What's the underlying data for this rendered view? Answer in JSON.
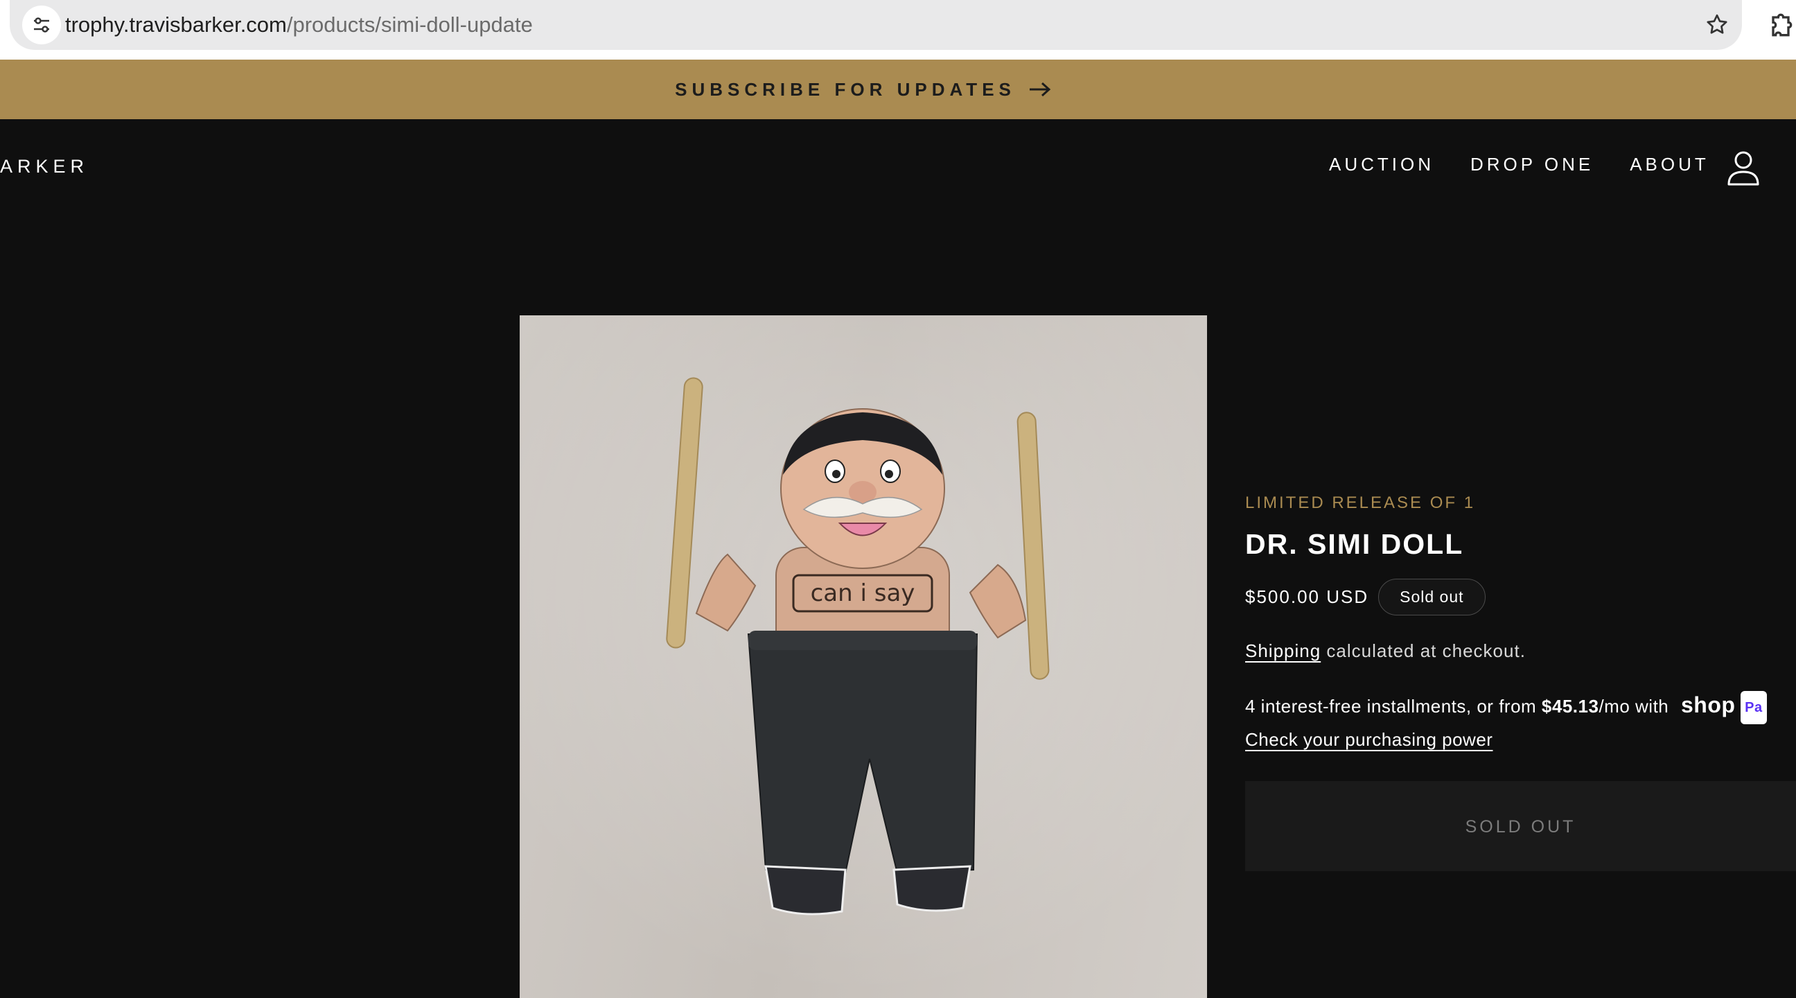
{
  "browser": {
    "url_domain": "trophy.travisbarker.com",
    "url_path": "/products/simi-doll-update"
  },
  "announcement": {
    "text": "SUBSCRIBE FOR UPDATES"
  },
  "header": {
    "brand": "ARKER",
    "nav": [
      "AUCTION",
      "DROP ONE",
      "ABOUT"
    ]
  },
  "product": {
    "eyebrow": "LIMITED RELEASE OF 1",
    "title": "DR. SIMI DOLL",
    "price": "$500.00 USD",
    "badge": "Sold out",
    "shipping_link": "Shipping",
    "shipping_text": " calculated at checkout.",
    "installments_prefix": "4 interest-free installments, or from ",
    "installments_amount": "$45.13",
    "installments_suffix": "/mo with ",
    "shop_logo": "shop",
    "pay_badge": "Pa",
    "purchasing_power_link": "Check your purchasing power",
    "button_label": "SOLD OUT"
  },
  "colors": {
    "gold": "#aa8b51",
    "background": "#0f0f0f",
    "button_bg": "#1a1a1a"
  }
}
